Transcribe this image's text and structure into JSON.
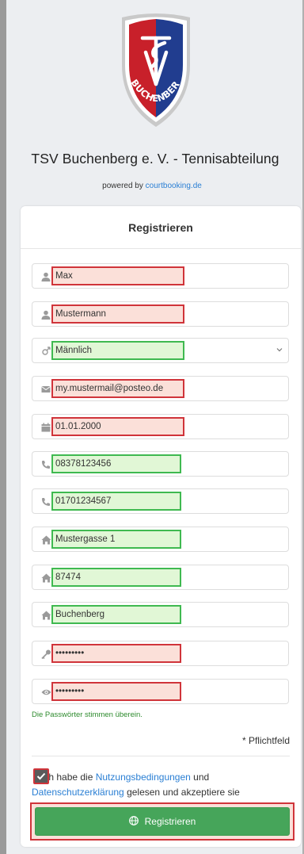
{
  "club": {
    "name": "TSV Buchenberg e. V. - Tennisabteilung",
    "logo_text": "BUCHENBERG",
    "logo_initials": "TSV"
  },
  "powered": {
    "prefix": "powered by",
    "link": "courtbooking.de"
  },
  "form": {
    "title": "Registrieren",
    "fields": [
      {
        "icon": "user-icon",
        "value": "Max",
        "state": "invalid"
      },
      {
        "icon": "user-icon",
        "value": "Mustermann",
        "state": "invalid"
      },
      {
        "icon": "gender-icon",
        "value": "Männlich",
        "state": "valid",
        "type": "select"
      },
      {
        "icon": "envelope-icon",
        "value": "my.mustermail@posteo.de",
        "state": "invalid"
      },
      {
        "icon": "calendar-icon",
        "value": "01.01.2000",
        "state": "invalid"
      },
      {
        "icon": "phone-icon",
        "value": "08378123456",
        "state": "valid"
      },
      {
        "icon": "phone-icon",
        "value": "01701234567",
        "state": "valid"
      },
      {
        "icon": "home-icon",
        "value": "Mustergasse 1",
        "state": "valid"
      },
      {
        "icon": "home-icon",
        "value": "87474",
        "state": "valid"
      },
      {
        "icon": "home-icon",
        "value": "Buchenberg",
        "state": "valid"
      },
      {
        "icon": "key-icon",
        "value": "•••••••••",
        "state": "invalid"
      },
      {
        "icon": "eye-icon",
        "value": "•••••••••",
        "state": "invalid"
      }
    ],
    "password_match_message": "Die Passwörter stimmen überein.",
    "required_note": "* Pflichtfeld",
    "terms": {
      "part1": "Ich habe die ",
      "link1": "Nutzungsbedingungen",
      "part2": " und ",
      "link2": "Datenschutzerklärung",
      "part3": " gelesen und akzeptiere sie"
    },
    "submit_label": "Registrieren"
  },
  "colors": {
    "invalid_border": "#d0343a",
    "invalid_bg": "#fbe0d9",
    "valid_border": "#3fb950",
    "valid_bg": "#e1f7d6",
    "button": "#46a55a",
    "link": "#2a7fd4"
  }
}
